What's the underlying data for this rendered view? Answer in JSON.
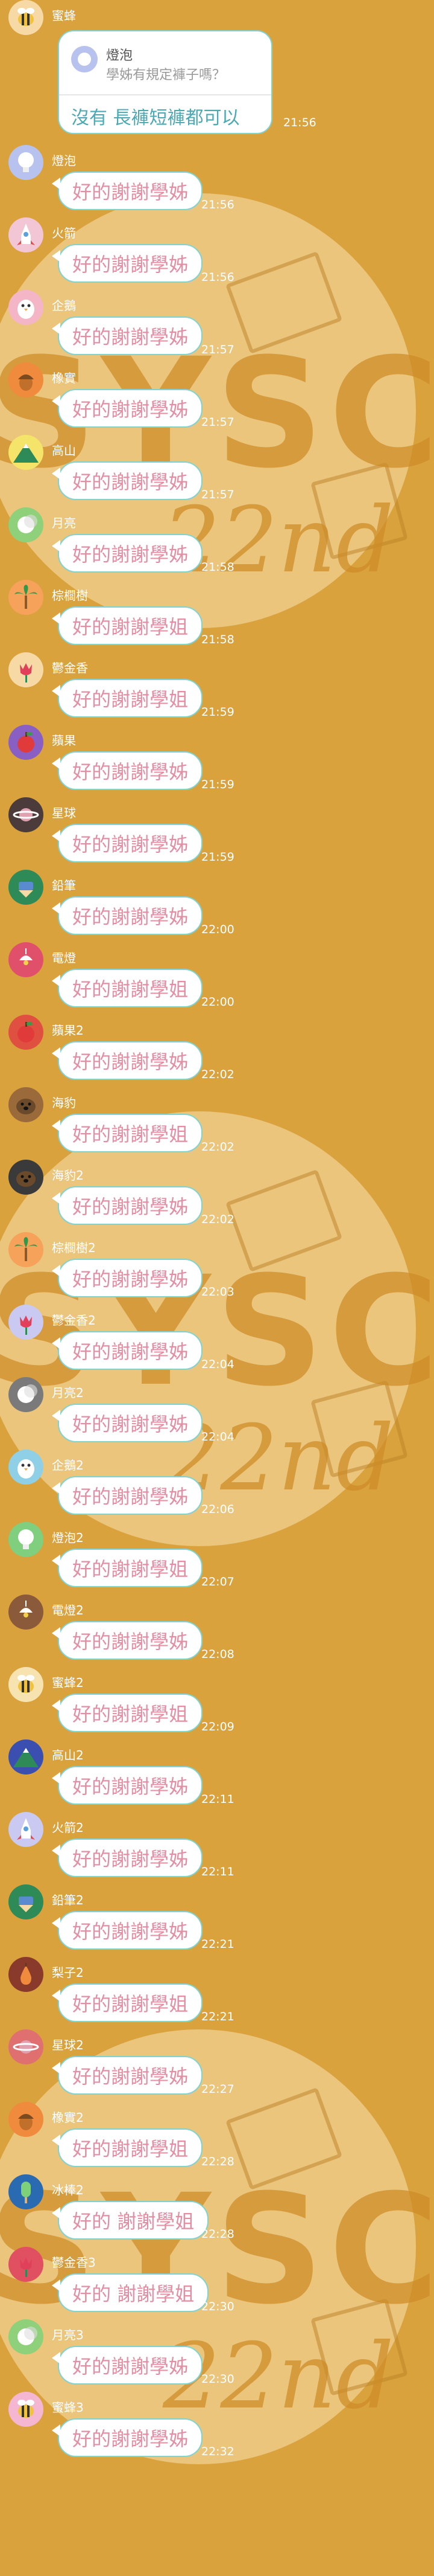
{
  "watermark": {
    "big_text": "SYSC",
    "small_text": "22nd"
  },
  "first_message": {
    "sender": "蜜蜂",
    "avatar_icon": "bee-icon",
    "quoted": {
      "name": "燈泡",
      "text": "學姊有規定褲子嗎？"
    },
    "text": "沒有 長褲短褲都可以",
    "time": "21:56"
  },
  "messages": [
    {
      "sender": "燈泡",
      "text": "好的謝謝學姊",
      "time": "21:56",
      "avatar_icon": "lightbulb-icon",
      "avatar_bg": "#b8c2ee"
    },
    {
      "sender": "火箭",
      "text": "好的謝謝學姊",
      "time": "21:56",
      "avatar_icon": "rocket-icon",
      "avatar_bg": "#f2c6d5"
    },
    {
      "sender": "企鵝",
      "text": "好的謝謝學姊",
      "time": "21:57",
      "avatar_icon": "penguin-icon",
      "avatar_bg": "#f4b6c6"
    },
    {
      "sender": "橡實",
      "text": "好的謝謝學姊",
      "time": "21:57",
      "avatar_icon": "acorn-icon",
      "avatar_bg": "#f08a3c"
    },
    {
      "sender": "高山",
      "text": "好的謝謝學姊",
      "time": "21:57",
      "avatar_icon": "mountain-icon",
      "avatar_bg": "#f5e46a"
    },
    {
      "sender": "月亮",
      "text": "好的謝謝學姊",
      "time": "21:58",
      "avatar_icon": "moon-icon",
      "avatar_bg": "#8fd07a"
    },
    {
      "sender": "棕櫚樹",
      "text": "好的謝謝學姐",
      "time": "21:58",
      "avatar_icon": "palm-tree-icon",
      "avatar_bg": "#f7a25a"
    },
    {
      "sender": "鬱金香",
      "text": "好的謝謝學姐",
      "time": "21:59",
      "avatar_icon": "tulip-icon",
      "avatar_bg": "#f6d9a4"
    },
    {
      "sender": "蘋果",
      "text": "好的謝謝學姊",
      "time": "21:59",
      "avatar_icon": "apple-icon",
      "avatar_bg": "#8a5fc4"
    },
    {
      "sender": "星球",
      "text": "好的謝謝學姊",
      "time": "21:59",
      "avatar_icon": "planet-icon",
      "avatar_bg": "#4b3b3b"
    },
    {
      "sender": "鉛筆",
      "text": "好的謝謝學姊",
      "time": "22:00",
      "avatar_icon": "pencil-icon",
      "avatar_bg": "#2e8b57"
    },
    {
      "sender": "電燈",
      "text": "好的謝謝學姐",
      "time": "22:00",
      "avatar_icon": "lamp-icon",
      "avatar_bg": "#e0506a"
    },
    {
      "sender": "蘋果2",
      "text": "好的謝謝學姊",
      "time": "22:02",
      "avatar_icon": "apple-icon",
      "avatar_bg": "#e05040"
    },
    {
      "sender": "海豹",
      "text": "好的謝謝學姐",
      "time": "22:02",
      "avatar_icon": "seal-icon",
      "avatar_bg": "#9a6a3a"
    },
    {
      "sender": "海豹2",
      "text": "好的謝謝學姊",
      "time": "22:02",
      "avatar_icon": "seal-icon",
      "avatar_bg": "#3a3a3a"
    },
    {
      "sender": "棕櫚樹2",
      "text": "好的謝謝學姊",
      "time": "22:03",
      "avatar_icon": "palm-tree-icon",
      "avatar_bg": "#f7a25a"
    },
    {
      "sender": "鬱金香2",
      "text": "好的謝謝學姊",
      "time": "22:04",
      "avatar_icon": "tulip-icon",
      "avatar_bg": "#c9c9f2"
    },
    {
      "sender": "月亮2",
      "text": "好的謝謝學姊",
      "time": "22:04",
      "avatar_icon": "moon-icon",
      "avatar_bg": "#7a7a7a"
    },
    {
      "sender": "企鵝2",
      "text": "好的謝謝學姊",
      "time": "22:06",
      "avatar_icon": "penguin-icon",
      "avatar_bg": "#8fd0e6"
    },
    {
      "sender": "燈泡2",
      "text": "好的謝謝學姐",
      "time": "22:07",
      "avatar_icon": "lightbulb-icon",
      "avatar_bg": "#7fcf7f"
    },
    {
      "sender": "電燈2",
      "text": "好的謝謝學姊",
      "time": "22:08",
      "avatar_icon": "lamp-icon",
      "avatar_bg": "#8a5a3a"
    },
    {
      "sender": "蜜蜂2",
      "text": "好的謝謝學姐",
      "time": "22:09",
      "avatar_icon": "bee-icon",
      "avatar_bg": "#f6e3b0"
    },
    {
      "sender": "高山2",
      "text": "好的謝謝學姊",
      "time": "22:11",
      "avatar_icon": "mountain-icon",
      "avatar_bg": "#3a4fb0"
    },
    {
      "sender": "火箭2",
      "text": "好的謝謝學姊",
      "time": "22:11",
      "avatar_icon": "rocket-icon",
      "avatar_bg": "#c9c9f2"
    },
    {
      "sender": "鉛筆2",
      "text": "好的謝謝學姊",
      "time": "22:21",
      "avatar_icon": "pencil-icon",
      "avatar_bg": "#2e8b57"
    },
    {
      "sender": "梨子2",
      "text": "好的謝謝學姐",
      "time": "22:21",
      "avatar_icon": "pear-icon",
      "avatar_bg": "#8a3a2a"
    },
    {
      "sender": "星球2",
      "text": "好的謝謝學姊",
      "time": "22:27",
      "avatar_icon": "planet-icon",
      "avatar_bg": "#e07070"
    },
    {
      "sender": "橡實2",
      "text": "好的謝謝學姐",
      "time": "22:28",
      "avatar_icon": "acorn-icon",
      "avatar_bg": "#f08a3c"
    },
    {
      "sender": "冰棒2",
      "text": "好的 謝謝學姐",
      "time": "22:28",
      "avatar_icon": "popsicle-icon",
      "avatar_bg": "#2a6ab0"
    },
    {
      "sender": "鬱金香3",
      "text": "好的 謝謝學姐",
      "time": "22:30",
      "avatar_icon": "tulip-icon",
      "avatar_bg": "#e05060"
    },
    {
      "sender": "月亮3",
      "text": "好的謝謝學姊",
      "time": "22:30",
      "avatar_icon": "moon-icon",
      "avatar_bg": "#8fd07a"
    },
    {
      "sender": "蜜蜂3",
      "text": "好的謝謝學姊",
      "time": "22:32",
      "avatar_icon": "bee-icon",
      "avatar_bg": "#f4b6d0"
    }
  ]
}
